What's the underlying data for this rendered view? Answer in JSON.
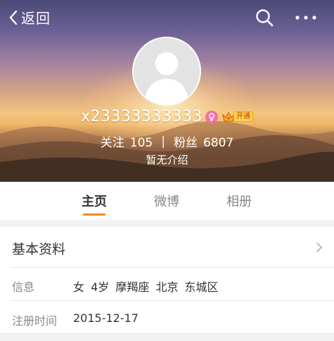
{
  "nav": {
    "back_label": "返回"
  },
  "profile": {
    "username": "x23333333333",
    "vip_label": "开通",
    "follow_label": "关注",
    "follow_count": "105",
    "fans_label": "粉丝",
    "fans_count": "6807",
    "intro": "暂无介绍"
  },
  "tabs": [
    {
      "label": "主页",
      "active": true
    },
    {
      "label": "微博",
      "active": false
    },
    {
      "label": "相册",
      "active": false
    }
  ],
  "info": {
    "title": "基本资料",
    "rows": [
      {
        "label": "信息",
        "value": "女 4岁 摩羯座 北京 东城区"
      },
      {
        "label": "注册时间",
        "value": "2015-12-17"
      }
    ]
  },
  "colors": {
    "accent": "#f08a24",
    "gender_badge": "#f36fa8",
    "vip_gold": "#ffd24a"
  },
  "icons": [
    "back-chevron-icon",
    "search-icon",
    "more-dots-icon",
    "female-icon",
    "vip-crown-icon",
    "chevron-right-icon"
  ]
}
